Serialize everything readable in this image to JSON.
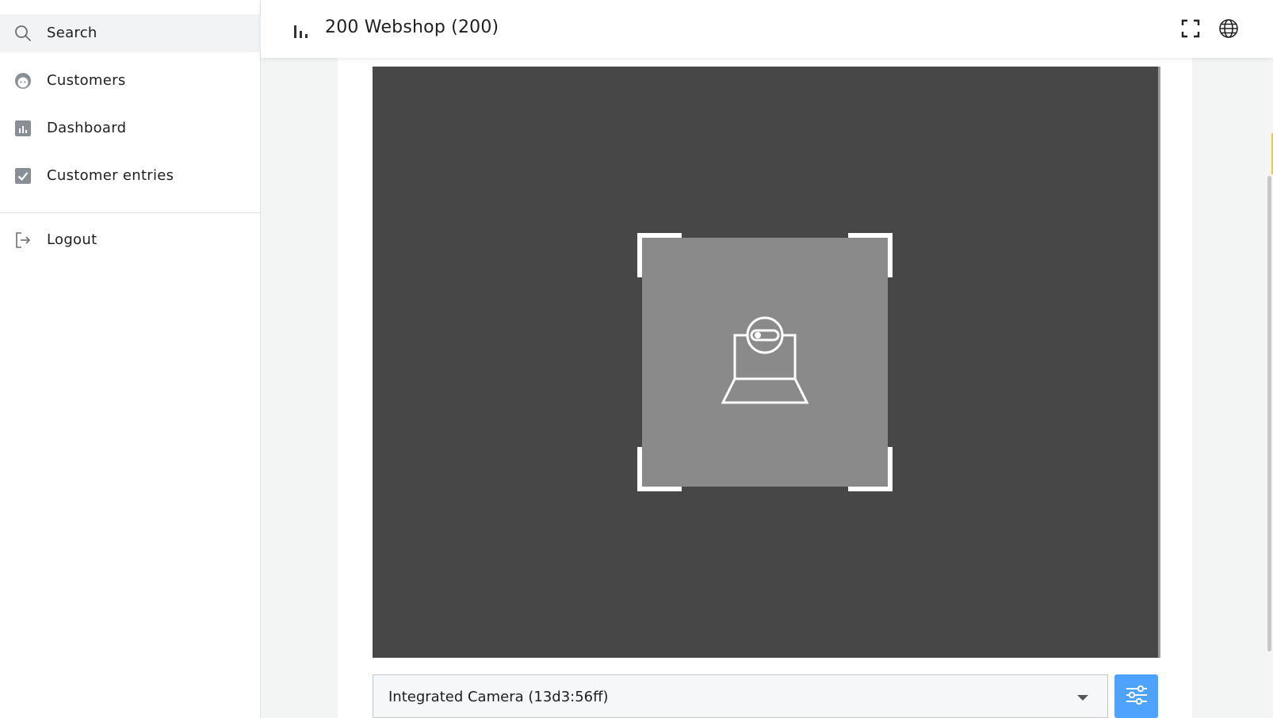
{
  "sidebar": {
    "items": [
      {
        "label": "Search",
        "icon": "search-icon",
        "active": true
      },
      {
        "label": "Customers",
        "icon": "face-icon"
      },
      {
        "label": "Dashboard",
        "icon": "dashboard-icon"
      },
      {
        "label": "Customer entries",
        "icon": "checkbox-icon"
      }
    ],
    "logout": {
      "label": "Logout",
      "icon": "logout-icon"
    }
  },
  "header": {
    "title": "200 Webshop (200)",
    "icon": "bar-chart-icon",
    "actions": [
      "fullscreen-icon",
      "globe-icon"
    ]
  },
  "scanner": {
    "placeholder_icon": "webcam-icon",
    "camera_select": {
      "value": "Integrated Camera (13d3:56ff)"
    },
    "settings_icon": "sliders-icon"
  },
  "colors": {
    "accent": "#4da3ff",
    "camera_bg": "#474747",
    "placeholder_bg": "#8a8a8b",
    "sidebar_active": "#f2f3f4"
  }
}
